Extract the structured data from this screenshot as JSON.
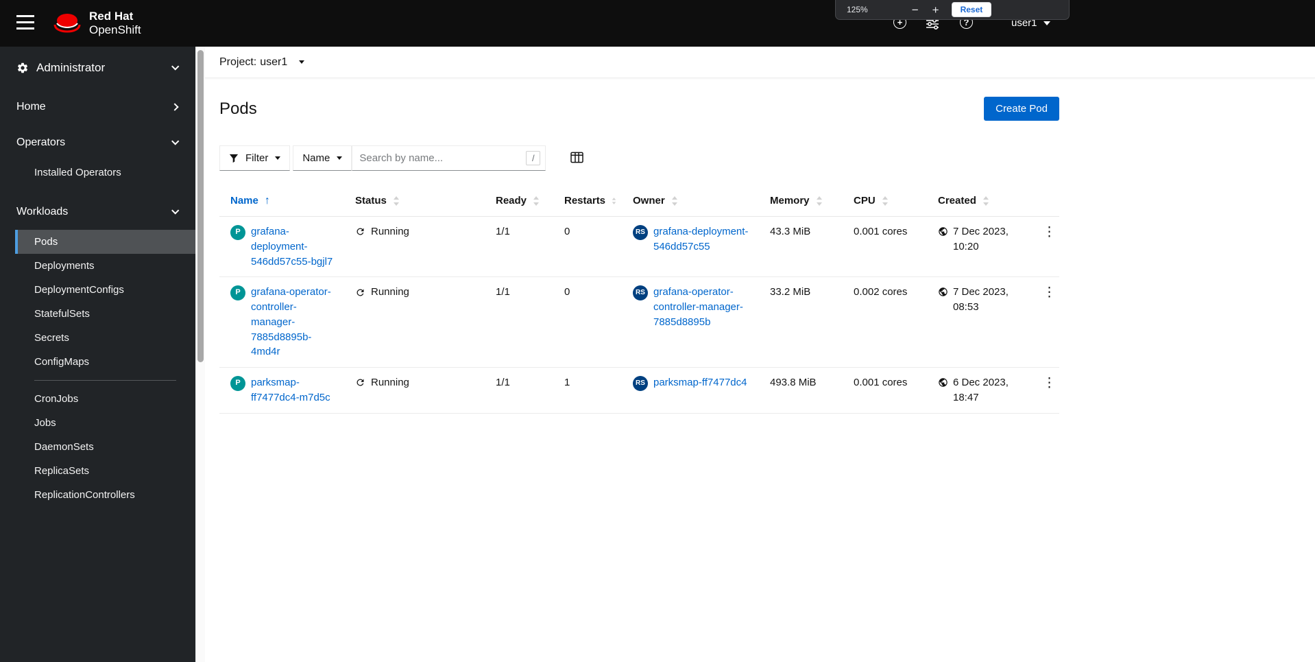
{
  "colors": {
    "primary_blue": "#0066cc",
    "link_blue": "#0066cc",
    "pod_badge": "#009596",
    "replicaset_badge": "#004080",
    "masthead_background": "#0e0e0e",
    "sidebar_background": "#212427",
    "nav_selected_background": "#4f5255",
    "nav_selected_border": "#4d9de0",
    "redhat_red": "#ee0000"
  },
  "masthead": {
    "brand_line1": "Red Hat",
    "brand_line2": "OpenShift",
    "user_menu_label": "user1",
    "zoom_popup": {
      "level": "125%",
      "zoom_out_label": "−",
      "zoom_in_label": "+",
      "reset_label": "Reset"
    }
  },
  "sidebar": {
    "perspective_label": "Administrator",
    "nav": {
      "home_label": "Home",
      "operators_label": "Operators",
      "operators_children": [
        "Installed Operators"
      ],
      "workloads_label": "Workloads",
      "workloads_children": [
        "Pods",
        "Deployments",
        "DeploymentConfigs",
        "StatefulSets",
        "Secrets",
        "ConfigMaps",
        "CronJobs",
        "Jobs",
        "DaemonSets",
        "ReplicaSets",
        "ReplicationControllers"
      ],
      "selected_item": "Pods"
    }
  },
  "project_bar": {
    "label": "Project:",
    "value": "user1"
  },
  "page": {
    "title": "Pods",
    "create_button_label": "Create Pod"
  },
  "toolbar": {
    "filter_label": "Filter",
    "attribute_selector_label": "Name",
    "search_placeholder": "Search by name...",
    "shortcut_hint": "/"
  },
  "table": {
    "columns": [
      "Name",
      "Status",
      "Ready",
      "Restarts",
      "Owner",
      "Memory",
      "CPU",
      "Created"
    ],
    "sort": {
      "column": "Name",
      "direction": "ascending"
    },
    "rows": [
      {
        "badge": "P",
        "name": "grafana-deployment-546dd57c55-bgjl7",
        "status": "Running",
        "ready": "1/1",
        "restarts": "0",
        "owner_badge": "RS",
        "owner": "grafana-deployment-546dd57c55",
        "memory": "43.3 MiB",
        "cpu": "0.001 cores",
        "created": "7 Dec 2023, 10:20"
      },
      {
        "badge": "P",
        "name": "grafana-operator-controller-manager-7885d8895b-4md4r",
        "status": "Running",
        "ready": "1/1",
        "restarts": "0",
        "owner_badge": "RS",
        "owner": "grafana-operator-controller-manager-7885d8895b",
        "memory": "33.2 MiB",
        "cpu": "0.002 cores",
        "created": "7 Dec 2023, 08:53"
      },
      {
        "badge": "P",
        "name": "parksmap-ff7477dc4-m7d5c",
        "status": "Running",
        "ready": "1/1",
        "restarts": "1",
        "owner_badge": "RS",
        "owner": "parksmap-ff7477dc4",
        "memory": "493.8 MiB",
        "cpu": "0.001 cores",
        "created": "6 Dec 2023, 18:47"
      }
    ]
  },
  "icons": {
    "menu": "hamburger",
    "quick_create": "+",
    "help": "?",
    "sliders": "sliders",
    "filter": "funnel",
    "columns": "table-columns",
    "running": "sync-arrows",
    "created": "globe",
    "sort_unsorted": "up-down-arrows",
    "sort_ascending": "↑",
    "kebab": "⋮"
  }
}
